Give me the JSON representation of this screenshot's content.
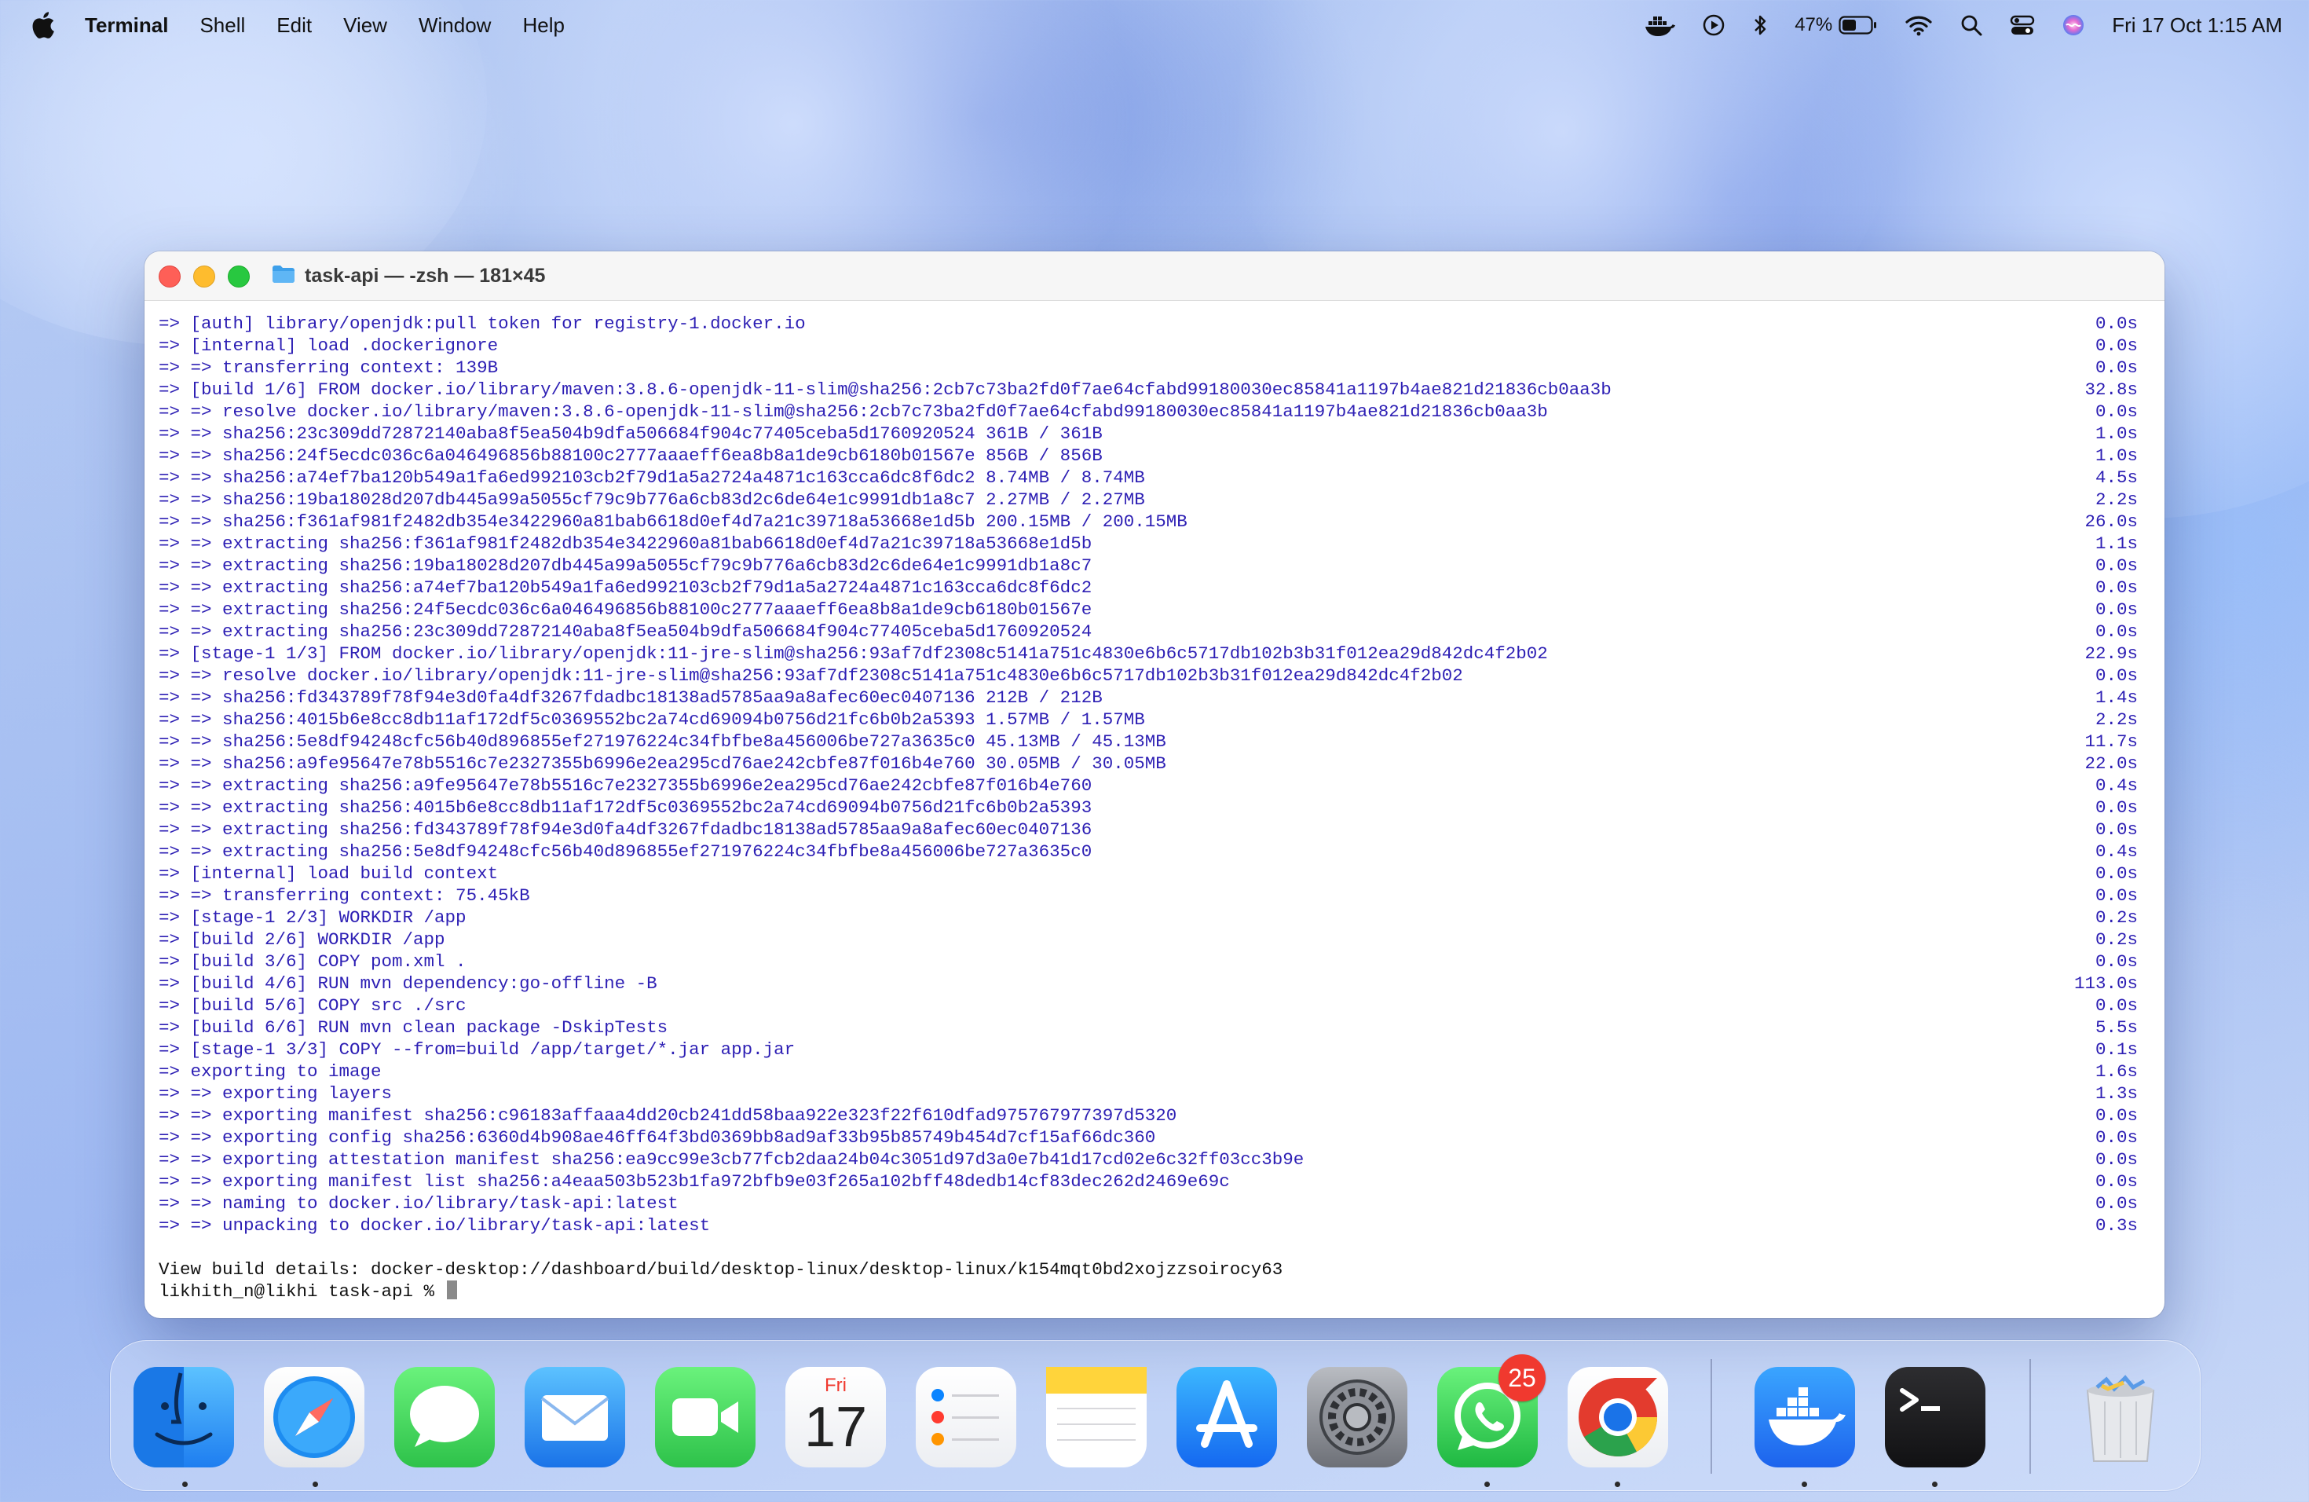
{
  "menubar": {
    "app_name": "Terminal",
    "menus": [
      "Shell",
      "Edit",
      "View",
      "Window",
      "Help"
    ],
    "battery_percent": "47%",
    "clock": "Fri 17 Oct  1:15 AM",
    "status_icons": [
      "docker-icon",
      "play-circle-icon",
      "bluetooth-icon",
      "battery-icon",
      "wifi-icon",
      "search-icon",
      "control-center-icon",
      "siri-icon"
    ]
  },
  "window": {
    "title": "task-api — -zsh — 181×45",
    "lines": [
      {
        "text": "=> [auth] library/openjdk:pull token for registry-1.docker.io",
        "time": "0.0s"
      },
      {
        "text": "=> [internal] load .dockerignore",
        "time": "0.0s"
      },
      {
        "text": "=> => transferring context: 139B",
        "time": "0.0s"
      },
      {
        "text": "=> [build 1/6] FROM docker.io/library/maven:3.8.6-openjdk-11-slim@sha256:2cb7c73ba2fd0f7ae64cfabd99180030ec85841a1197b4ae821d21836cb0aa3b",
        "time": "32.8s"
      },
      {
        "text": "=> => resolve docker.io/library/maven:3.8.6-openjdk-11-slim@sha256:2cb7c73ba2fd0f7ae64cfabd99180030ec85841a1197b4ae821d21836cb0aa3b",
        "time": "0.0s"
      },
      {
        "text": "=> => sha256:23c309dd72872140aba8f5ea504b9dfa506684f904c77405ceba5d1760920524 361B / 361B",
        "time": "1.0s"
      },
      {
        "text": "=> => sha256:24f5ecdc036c6a046496856b88100c2777aaaeff6ea8b8a1de9cb6180b01567e 856B / 856B",
        "time": "1.0s"
      },
      {
        "text": "=> => sha256:a74ef7ba120b549a1fa6ed992103cb2f79d1a5a2724a4871c163cca6dc8f6dc2 8.74MB / 8.74MB",
        "time": "4.5s"
      },
      {
        "text": "=> => sha256:19ba18028d207db445a99a5055cf79c9b776a6cb83d2c6de64e1c9991db1a8c7 2.27MB / 2.27MB",
        "time": "2.2s"
      },
      {
        "text": "=> => sha256:f361af981f2482db354e3422960a81bab6618d0ef4d7a21c39718a53668e1d5b 200.15MB / 200.15MB",
        "time": "26.0s"
      },
      {
        "text": "=> => extracting sha256:f361af981f2482db354e3422960a81bab6618d0ef4d7a21c39718a53668e1d5b",
        "time": "1.1s"
      },
      {
        "text": "=> => extracting sha256:19ba18028d207db445a99a5055cf79c9b776a6cb83d2c6de64e1c9991db1a8c7",
        "time": "0.0s"
      },
      {
        "text": "=> => extracting sha256:a74ef7ba120b549a1fa6ed992103cb2f79d1a5a2724a4871c163cca6dc8f6dc2",
        "time": "0.0s"
      },
      {
        "text": "=> => extracting sha256:24f5ecdc036c6a046496856b88100c2777aaaeff6ea8b8a1de9cb6180b01567e",
        "time": "0.0s"
      },
      {
        "text": "=> => extracting sha256:23c309dd72872140aba8f5ea504b9dfa506684f904c77405ceba5d1760920524",
        "time": "0.0s"
      },
      {
        "text": "=> [stage-1 1/3] FROM docker.io/library/openjdk:11-jre-slim@sha256:93af7df2308c5141a751c4830e6b6c5717db102b3b31f012ea29d842dc4f2b02",
        "time": "22.9s"
      },
      {
        "text": "=> => resolve docker.io/library/openjdk:11-jre-slim@sha256:93af7df2308c5141a751c4830e6b6c5717db102b3b31f012ea29d842dc4f2b02",
        "time": "0.0s"
      },
      {
        "text": "=> => sha256:fd343789f78f94e3d0fa4df3267fdadbc18138ad5785aa9a8afec60ec0407136 212B / 212B",
        "time": "1.4s"
      },
      {
        "text": "=> => sha256:4015b6e8cc8db11af172df5c0369552bc2a74cd69094b0756d21fc6b0b2a5393 1.57MB / 1.57MB",
        "time": "2.2s"
      },
      {
        "text": "=> => sha256:5e8df94248cfc56b40d896855ef271976224c34fbfbe8a456006be727a3635c0 45.13MB / 45.13MB",
        "time": "11.7s"
      },
      {
        "text": "=> => sha256:a9fe95647e78b5516c7e2327355b6996e2ea295cd76ae242cbfe87f016b4e760 30.05MB / 30.05MB",
        "time": "22.0s"
      },
      {
        "text": "=> => extracting sha256:a9fe95647e78b5516c7e2327355b6996e2ea295cd76ae242cbfe87f016b4e760",
        "time": "0.4s"
      },
      {
        "text": "=> => extracting sha256:4015b6e8cc8db11af172df5c0369552bc2a74cd69094b0756d21fc6b0b2a5393",
        "time": "0.0s"
      },
      {
        "text": "=> => extracting sha256:fd343789f78f94e3d0fa4df3267fdadbc18138ad5785aa9a8afec60ec0407136",
        "time": "0.0s"
      },
      {
        "text": "=> => extracting sha256:5e8df94248cfc56b40d896855ef271976224c34fbfbe8a456006be727a3635c0",
        "time": "0.4s"
      },
      {
        "text": "=> [internal] load build context",
        "time": "0.0s"
      },
      {
        "text": "=> => transferring context: 75.45kB",
        "time": "0.0s"
      },
      {
        "text": "=> [stage-1 2/3] WORKDIR /app",
        "time": "0.2s"
      },
      {
        "text": "=> [build 2/6] WORKDIR /app",
        "time": "0.2s"
      },
      {
        "text": "=> [build 3/6] COPY pom.xml .",
        "time": "0.0s"
      },
      {
        "text": "=> [build 4/6] RUN mvn dependency:go-offline -B",
        "time": "113.0s"
      },
      {
        "text": "=> [build 5/6] COPY src ./src",
        "time": "0.0s"
      },
      {
        "text": "=> [build 6/6] RUN mvn clean package -DskipTests",
        "time": "5.5s"
      },
      {
        "text": "=> [stage-1 3/3] COPY --from=build /app/target/*.jar app.jar",
        "time": "0.1s"
      },
      {
        "text": "=> exporting to image",
        "time": "1.6s"
      },
      {
        "text": "=> => exporting layers",
        "time": "1.3s"
      },
      {
        "text": "=> => exporting manifest sha256:c96183affaaa4dd20cb241dd58baa922e323f22f610dfad975767977397d5320",
        "time": "0.0s"
      },
      {
        "text": "=> => exporting config sha256:6360d4b908ae46ff64f3bd0369bb8ad9af33b95b85749b454d7cf15af66dc360",
        "time": "0.0s"
      },
      {
        "text": "=> => exporting attestation manifest sha256:ea9cc99e3cb77fcb2daa24b04c3051d97d3a0e7b41d17cd02e6c32ff03cc3b9e",
        "time": "0.0s"
      },
      {
        "text": "=> => exporting manifest list sha256:a4eaa503b523b1fa972bfb9e03f265a102bff48dedb14cf83dec262d2469e69c",
        "time": "0.0s"
      },
      {
        "text": "=> => naming to docker.io/library/task-api:latest",
        "time": "0.0s"
      },
      {
        "text": "=> => unpacking to docker.io/library/task-api:latest",
        "time": "0.3s"
      }
    ],
    "build_details": "View build details: docker-desktop://dashboard/build/desktop-linux/desktop-linux/k154mqt0bd2xojzzsoirocy63",
    "prompt": "likhith_n@likhi task-api % "
  },
  "dock": {
    "calendar_day": "Fri",
    "calendar_date": "17",
    "whatsapp_badge": "25",
    "apps": [
      "finder",
      "safari",
      "messages",
      "mail",
      "facetime",
      "calendar",
      "reminders",
      "notes",
      "app-store",
      "system-settings",
      "whatsapp",
      "chrome",
      "docker",
      "terminal",
      "trash"
    ]
  },
  "colors": {
    "terminal_text": "#2d1fb4",
    "prompt_text": "#111111",
    "accent_close": "#fe5f57",
    "accent_min": "#febc2e",
    "accent_max": "#28c840"
  }
}
